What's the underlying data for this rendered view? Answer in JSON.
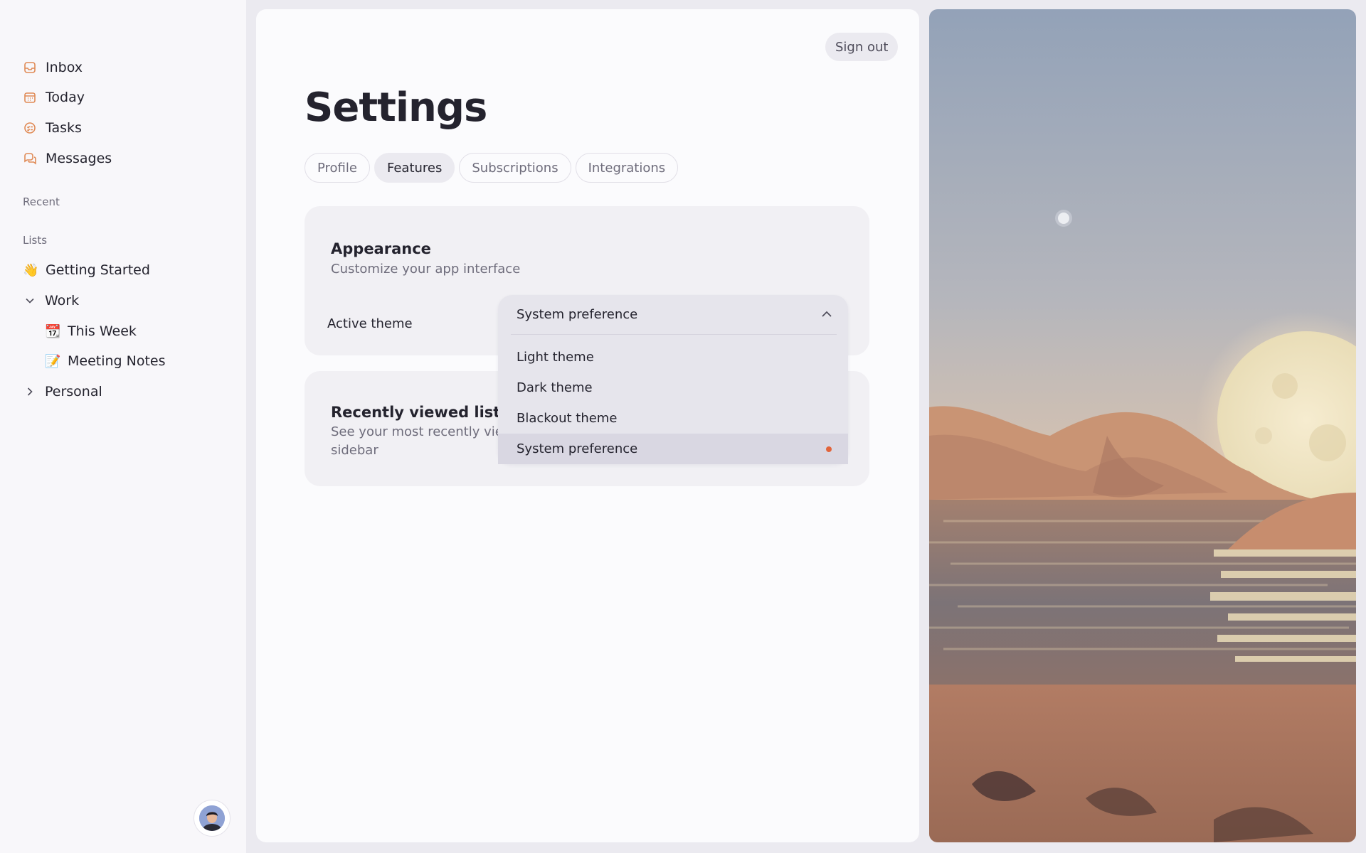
{
  "sidebar": {
    "nav": [
      {
        "label": "Inbox",
        "icon": "inbox-icon"
      },
      {
        "label": "Today",
        "icon": "calendar-icon"
      },
      {
        "label": "Tasks",
        "icon": "tasks-icon"
      },
      {
        "label": "Messages",
        "icon": "messages-icon"
      }
    ],
    "recent_label": "Recent",
    "lists_label": "Lists",
    "lists": [
      {
        "label": "Getting Started",
        "emoji": "👋"
      },
      {
        "label": "Work",
        "expanded": true
      },
      {
        "label": "This Week",
        "emoji": "📆"
      },
      {
        "label": "Meeting Notes",
        "emoji": "📝"
      },
      {
        "label": "Personal",
        "expanded": false
      }
    ]
  },
  "header": {
    "signout_label": "Sign out",
    "title": "Settings"
  },
  "tabs": [
    {
      "label": "Profile",
      "active": false
    },
    {
      "label": "Features",
      "active": true
    },
    {
      "label": "Subscriptions",
      "active": false
    },
    {
      "label": "Integrations",
      "active": false
    }
  ],
  "appearance": {
    "title": "Appearance",
    "subtitle": "Customize your app interface",
    "theme_label": "Active theme",
    "theme_value": "System preference",
    "options": [
      "Light theme",
      "Dark theme",
      "Blackout theme",
      "System preference"
    ]
  },
  "recent_lists": {
    "title": "Recently viewed lists",
    "subtitle": "See your most recently vie",
    "subtitle2": "sidebar"
  },
  "colors": {
    "accent": "#e2643b",
    "icon_orange": "#e08a55",
    "text": "#24232e",
    "muted": "#6e6c7b"
  }
}
